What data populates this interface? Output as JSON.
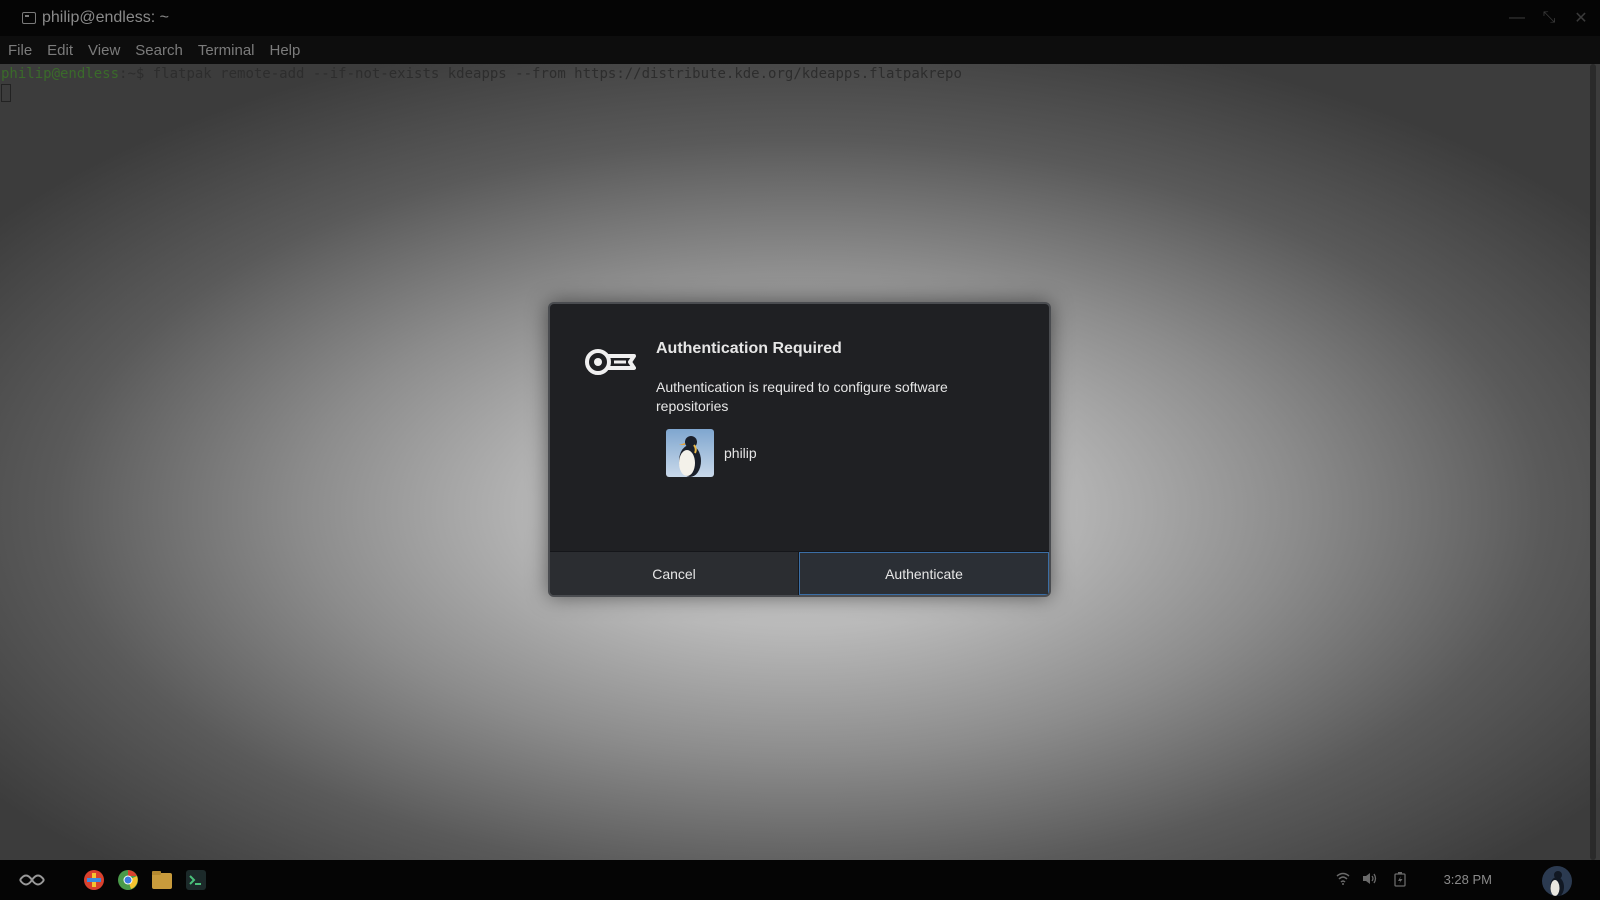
{
  "window": {
    "title": "philip@endless: ~",
    "controls": [
      "—",
      "⤡",
      "✕"
    ]
  },
  "menu": {
    "items": [
      "File",
      "Edit",
      "View",
      "Search",
      "Terminal",
      "Help"
    ]
  },
  "terminal": {
    "prompt_user": "philip@endless",
    "prompt_rest": ":~$ ",
    "command": "flatpak remote-add --if-not-exists kdeapps --from https://distribute.kde.org/kdeapps.flatpakrepo"
  },
  "dialog": {
    "title": "Authentication Required",
    "message": "Authentication is required to configure software repositories",
    "user": "philip",
    "cancel_label": "Cancel",
    "authenticate_label": "Authenticate"
  },
  "taskbar": {
    "apps": [
      "app-center-icon",
      "chrome-icon",
      "files-icon",
      "terminal-icon"
    ],
    "time": "3:28 PM"
  },
  "colors": {
    "accent": "#3b6ea5",
    "dialog_bg": "#1f2023"
  }
}
